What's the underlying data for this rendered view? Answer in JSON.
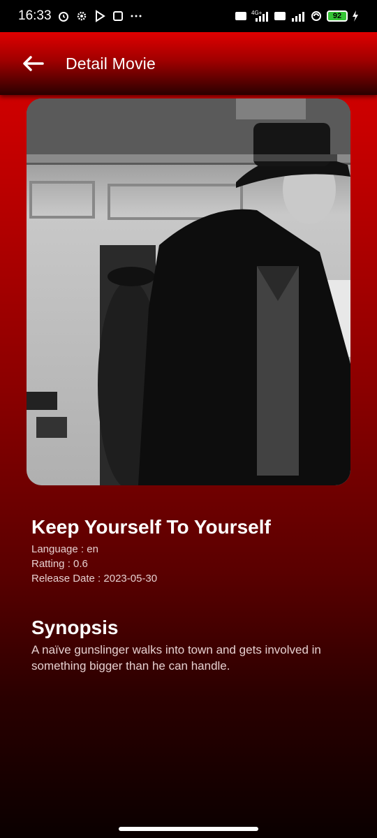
{
  "status_bar": {
    "time": "16:33",
    "battery": "92",
    "network": "4G+"
  },
  "app_bar": {
    "title": "Detail Movie",
    "back_icon": "arrow-left-icon"
  },
  "movie": {
    "title": "Keep Yourself To Yourself",
    "language_line": "Language : en",
    "rating_line": "Ratting : 0.6",
    "release_line": "Release Date : 2023-05-30"
  },
  "synopsis": {
    "heading": "Synopsis",
    "text": "A naïve gunslinger walks into town and gets involved in something bigger than he can handle."
  },
  "colors": {
    "accent": "#e00000",
    "status_bar_bg": "#000000",
    "battery_fill": "#35c435"
  }
}
